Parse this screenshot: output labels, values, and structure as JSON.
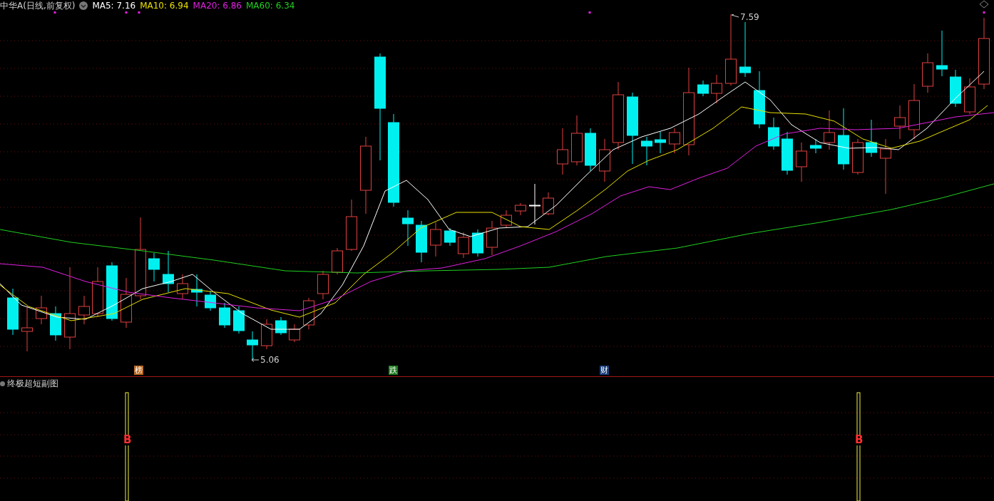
{
  "header": {
    "title": "中华A(日线,前复权)",
    "indicators": [
      {
        "label": "MA5: 7.16",
        "color": "#ffffff"
      },
      {
        "label": "MA10: 6.94",
        "color": "#e8e000"
      },
      {
        "label": "MA20: 6.86",
        "color": "#e020e0"
      },
      {
        "label": "MA60: 6.34",
        "color": "#20d020"
      }
    ]
  },
  "price_labels": [
    {
      "text": "5.06"
    },
    {
      "text": "7.59"
    }
  ],
  "event_markers": [
    {
      "text": "榜",
      "color": "#b8661c"
    },
    {
      "text": "跌",
      "color": "#1e7a1e"
    },
    {
      "text": "财",
      "color": "#1a3f7a"
    }
  ],
  "sub_chart": {
    "title": "终极超短副图",
    "signals": [
      {
        "text": "B"
      },
      {
        "text": "B"
      }
    ]
  }
}
